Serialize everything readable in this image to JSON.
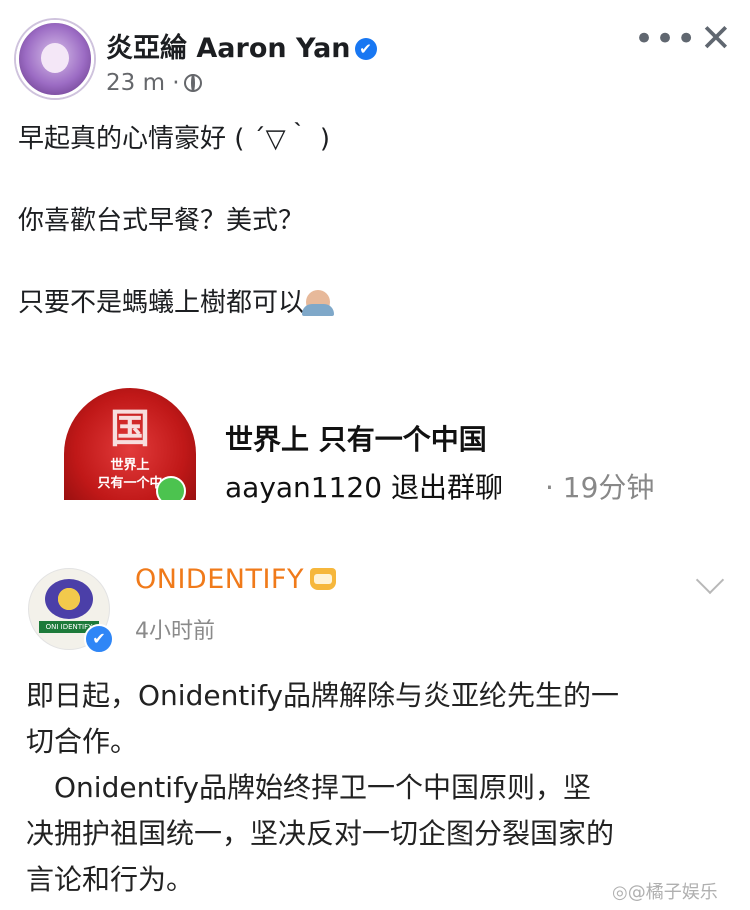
{
  "facebook_post": {
    "author": "炎亞綸 Aaron Yan",
    "verified_mark": "✔",
    "time": "23 m ·",
    "more_label": "•••",
    "close_label": "✕",
    "lines": [
      "早起真的心情豪好 ( ´▽｀ )",
      "你喜歡台式早餐？美式？",
      "只要不是螞蟻上樹都可以"
    ],
    "emoji": "shrugging-person-emoji"
  },
  "group_notice": {
    "avatar_glyph": "国",
    "avatar_line1": "世界上",
    "avatar_line2": "只有一个中",
    "title": "世界上 只有一个中国",
    "notice": "aayan1120 退出群聊",
    "time": "· 19分钟"
  },
  "weibo_post": {
    "name": "ONIDENTIFY",
    "time": "4小时前",
    "avatar_band": "ONI IDENTIFY",
    "verified_mark": "✔",
    "lines": [
      "即日起，Onidentify品牌解除与炎亚纶先生的一",
      "切合作。",
      "　Onidentify品牌始终捍卫一个中国原则，坚",
      "决拥护祖国统一，坚决反对一切企图分裂国家的",
      "言论和行为。"
    ]
  },
  "watermark": "◎@橘子娱乐",
  "colors": {
    "facebook_blue": "#1877f2",
    "weibo_orange": "#f07a1a",
    "red_avatar": "#c01818"
  }
}
